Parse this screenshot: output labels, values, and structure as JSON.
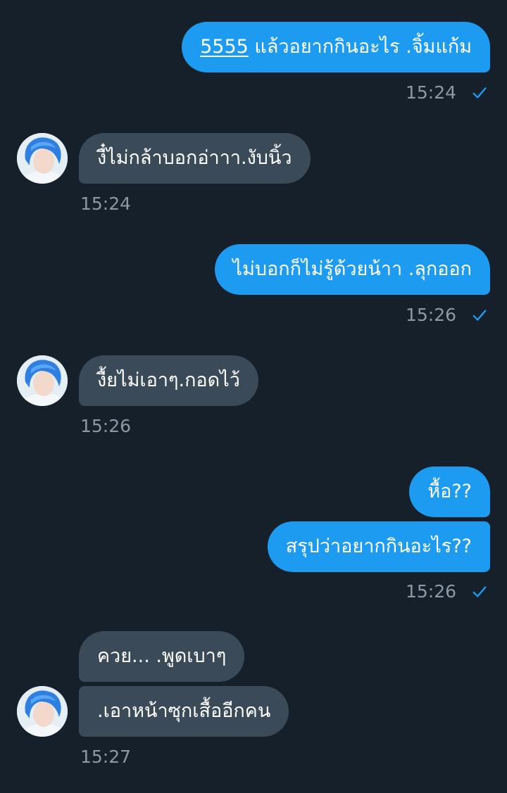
{
  "messages": [
    {
      "sender": "me",
      "link": "5555",
      "text": " แล้วอยากกินอะไร .จิ้มแก้ม",
      "time": "15:24"
    },
    {
      "sender": "them",
      "text": "งื๋ไม่กล้าบอกอ่าาา.งับนิ้ว",
      "time": "15:24"
    },
    {
      "sender": "me",
      "text": "ไม่บอกก็ไม่รู้ด้วยน้าา .ลุกออก",
      "time": "15:26"
    },
    {
      "sender": "them",
      "text": "งื้ยไม่เอาๆ.กอดไว้",
      "time": "15:26"
    },
    {
      "sender": "me",
      "text": "หื้อ??"
    },
    {
      "sender": "me",
      "text": "สรุปว่าอยากกินอะไร??",
      "time": "15:26"
    },
    {
      "sender": "them",
      "text": "ควย... .พูดเบาๆ"
    },
    {
      "sender": "them",
      "text": ".เอาหน้าซุกเสื้ออีกคน",
      "time": "15:27"
    }
  ],
  "colors": {
    "background": "#16202b",
    "sent_bubble": "#1d9bf0",
    "received_bubble": "#3a4a58",
    "timestamp": "#8b98a5",
    "read_check": "#1d9bf0"
  },
  "icons": {
    "read_receipt": "check-icon",
    "avatar": "profile-avatar"
  }
}
